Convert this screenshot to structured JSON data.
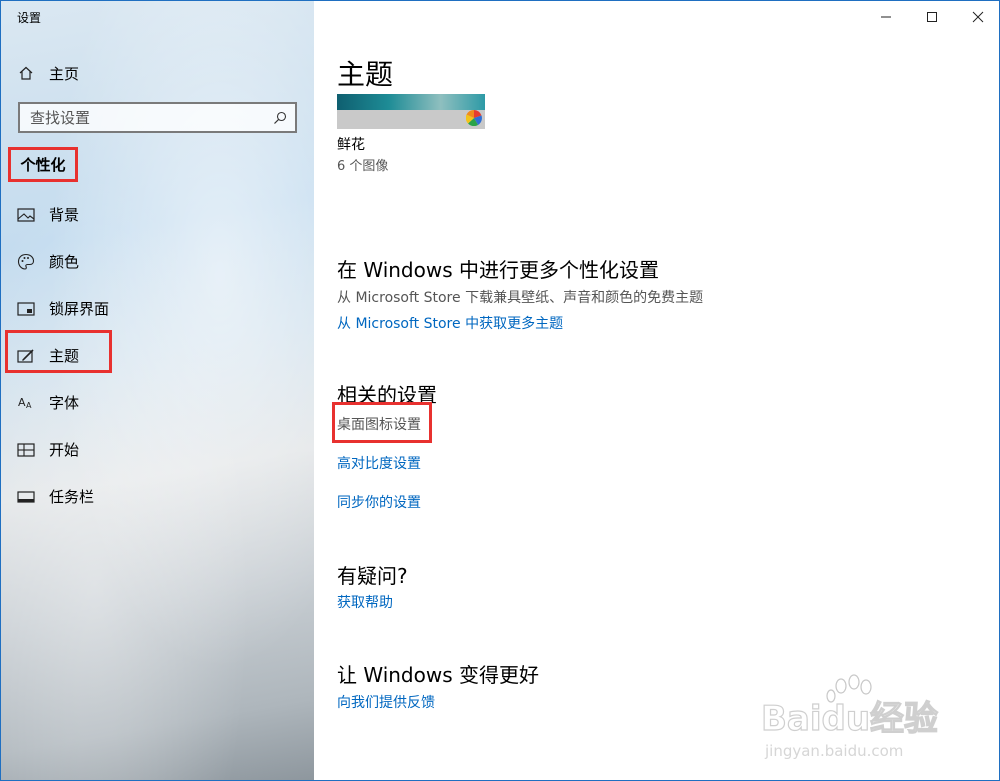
{
  "window": {
    "title": "设置"
  },
  "sidebar": {
    "home_label": "主页",
    "search_placeholder": "查找设置",
    "section_header": "个性化",
    "items": [
      {
        "label": "背景",
        "icon": "image-icon"
      },
      {
        "label": "颜色",
        "icon": "palette-icon"
      },
      {
        "label": "锁屏界面",
        "icon": "lock-screen-icon"
      },
      {
        "label": "主题",
        "icon": "theme-brush-icon"
      },
      {
        "label": "字体",
        "icon": "font-icon"
      },
      {
        "label": "开始",
        "icon": "start-icon"
      },
      {
        "label": "任务栏",
        "icon": "taskbar-icon"
      }
    ]
  },
  "main": {
    "title": "主题",
    "current_theme": {
      "name": "鲜花",
      "image_count": "6 个图像"
    },
    "more_section": {
      "heading": "在 Windows 中进行更多个性化设置",
      "description": "从 Microsoft Store 下载兼具壁纸、声音和颜色的免费主题",
      "link": "从 Microsoft Store 中获取更多主题"
    },
    "related_section": {
      "heading": "相关的设置",
      "links": [
        "桌面图标设置",
        "高对比度设置",
        "同步你的设置"
      ]
    },
    "help_section": {
      "heading": "有疑问?",
      "link": "获取帮助"
    },
    "feedback_section": {
      "heading": "让 Windows 变得更好",
      "link": "向我们提供反馈"
    }
  },
  "watermark": {
    "brand": "Baidu经验",
    "url": "jingyan.baidu.com"
  },
  "colors": {
    "accent_link": "#0067c0",
    "highlight_red": "#e8312f",
    "window_border": "#1f6fc1"
  }
}
